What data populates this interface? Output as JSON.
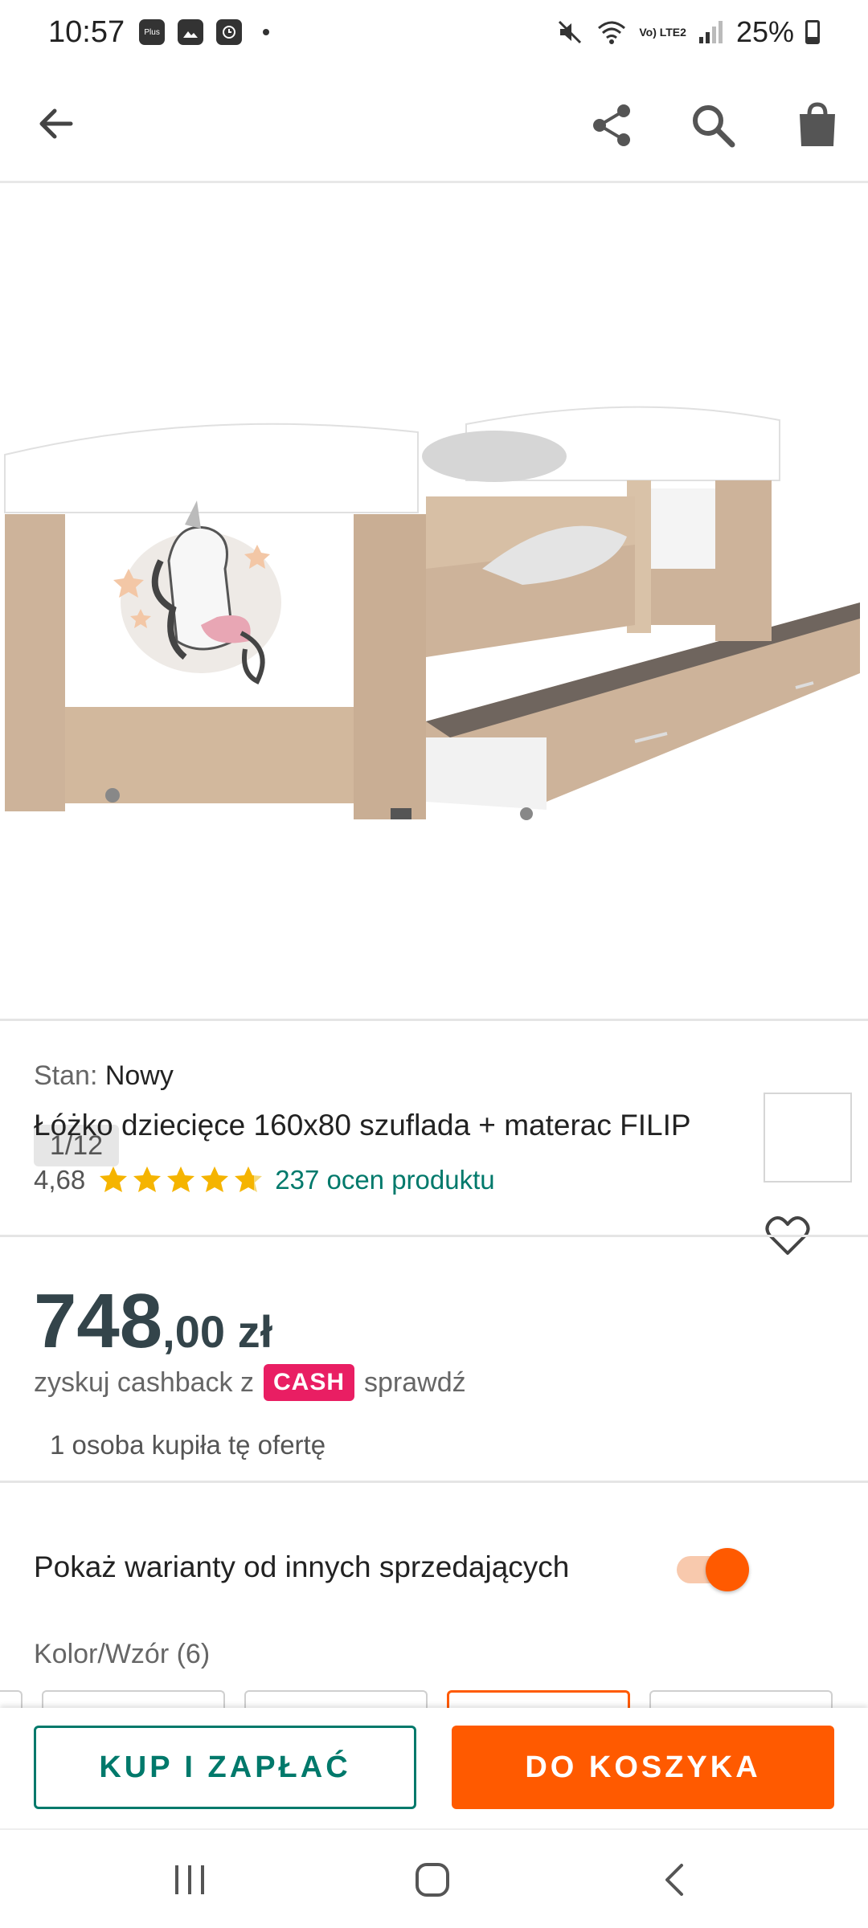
{
  "status_bar": {
    "time": "10:57",
    "battery": "25%",
    "lte_label": "Vo) LTE2",
    "lidl_label": "Plus"
  },
  "image": {
    "counter": "1/12"
  },
  "product": {
    "condition_label": "Stan:",
    "condition_value": "Nowy",
    "title": "Łóżko dziecięce 160x80 szuflada + materac FILIP",
    "rating_score": "4,68",
    "rating_count": "237 ocen produktu",
    "stars": 5
  },
  "price": {
    "integer": "748",
    "decimal": ",00 zł",
    "cashback_prefix": "zyskuj cashback z",
    "cashback_badge": "CASH",
    "cashback_link": "sprawdź",
    "bought": "1 osoba kupiła tę ofertę"
  },
  "variants": {
    "toggle_label": "Pokaż warianty od innych sprzedających",
    "toggle_on": true,
    "color_label": "Kolor/Wzór (6)"
  },
  "actions": {
    "buy_now": "KUP I ZAPŁAĆ",
    "add_to_cart": "DO KOSZYKA"
  },
  "colors": {
    "accent_orange": "#ff5a00",
    "accent_teal": "#00796b",
    "cash_pink": "#e91e63"
  }
}
